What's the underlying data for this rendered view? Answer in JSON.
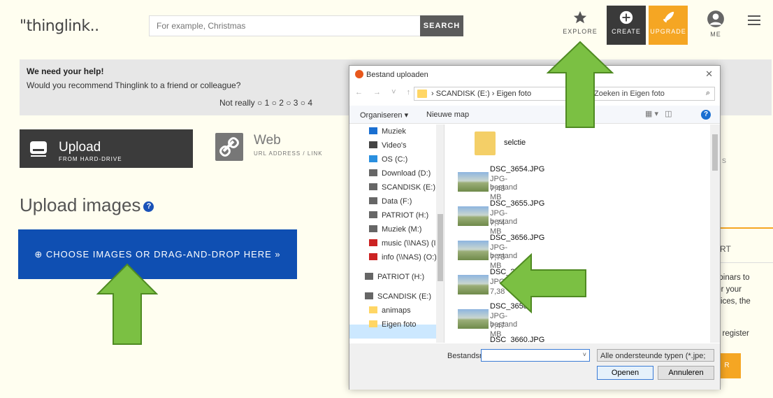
{
  "header": {
    "logo": "\"thinglink..",
    "search_placeholder": "For example, Christmas",
    "search_button": "SEARCH",
    "nav": {
      "explore": "EXPLORE",
      "create": "CREATE",
      "upgrade": "UPGRADE",
      "me": "ME"
    }
  },
  "help": {
    "title": "We need your help!",
    "question": "Would you recommend Thinglink to a friend or colleague?",
    "scale": "Not really ○ 1  ○ 2  ○ 3  ○ 4"
  },
  "tabs": {
    "upload_main": "Upload",
    "upload_sub": "FROM HARD-DRIVE",
    "web_main": "Web",
    "web_sub": "URL ADDRESS / LINK"
  },
  "upload_title": "Upload images",
  "choose_button": "⊕ CHOOSE IMAGES OR DRAG-AND-DROP HERE »",
  "right_column": {
    "ert": "ERT",
    "lines": [
      "ebinars to",
      "for your",
      "ctices, the",
      "",
      "ly register"
    ],
    "button": "R",
    "s_text": "s"
  },
  "dialog": {
    "title": "Bestand uploaden",
    "path_drive": "SCANDISK (E:)",
    "path_folder": "Eigen foto",
    "search_placeholder": "Zoeken in Eigen foto",
    "organize": "Organiseren ▾",
    "new_folder": "Nieuwe map",
    "nav_items": [
      {
        "label": "Muziek",
        "icon": "music-icon",
        "color": "#1a6fd1"
      },
      {
        "label": "Video's",
        "icon": "video-icon",
        "color": "#444444"
      },
      {
        "label": "OS (C:)",
        "icon": "drive-icon",
        "color": "#2a8fdf"
      },
      {
        "label": "Download (D:)",
        "icon": "drive-icon",
        "color": "#666666"
      },
      {
        "label": "SCANDISK (E:)",
        "icon": "drive-icon",
        "color": "#666666"
      },
      {
        "label": "Data (F:)",
        "icon": "drive-icon",
        "color": "#666666"
      },
      {
        "label": "PATRIOT (H:)",
        "icon": "drive-icon",
        "color": "#666666"
      },
      {
        "label": "Muziek (M:)",
        "icon": "drive-icon",
        "color": "#666666"
      },
      {
        "label": "music (\\\\NAS) (I",
        "icon": "network-drive-icon",
        "color": "#cc2222"
      },
      {
        "label": "info (\\\\NAS) (O:)",
        "icon": "network-drive-icon",
        "color": "#cc2222"
      },
      {
        "label": "PATRIOT (H:)",
        "icon": "drive-icon",
        "color": "#666666"
      },
      {
        "label": "SCANDISK (E:)",
        "icon": "drive-icon",
        "color": "#666666"
      },
      {
        "label": "animaps",
        "icon": "folder-icon",
        "color": "#ffd665"
      },
      {
        "label": "Eigen foto",
        "icon": "folder-icon",
        "color": "#ffd665"
      }
    ],
    "files": [
      {
        "name": "selctie",
        "type": "",
        "size": "",
        "folder": true
      },
      {
        "name": "DSC_3654.JPG",
        "type": "JPG-bestand",
        "size": "7,43 MB"
      },
      {
        "name": "DSC_3655.JPG",
        "type": "JPG-bestand",
        "size": "7,74 MB"
      },
      {
        "name": "DSC_3656.JPG",
        "type": "JPG-bestand",
        "size": "7,73 MB"
      },
      {
        "name": "DSC_365",
        "type": "JPG-",
        "size": "7,38"
      },
      {
        "name": "DSC_3658",
        "type": "JPG-bestand",
        "size": "7,47 MB"
      },
      {
        "name": "DSC_3660.JPG",
        "type": "",
        "size": ""
      }
    ],
    "filename_label": "Bestandsnaam:",
    "filetype": "Alle ondersteunde typen (*.jpe;",
    "open": "Openen",
    "cancel": "Annuleren"
  },
  "colors": {
    "create_bg": "#3a3a3a",
    "upgrade_bg": "#f5a623",
    "choose_bg": "#0f4fb2",
    "arrow": "#7bc043"
  }
}
